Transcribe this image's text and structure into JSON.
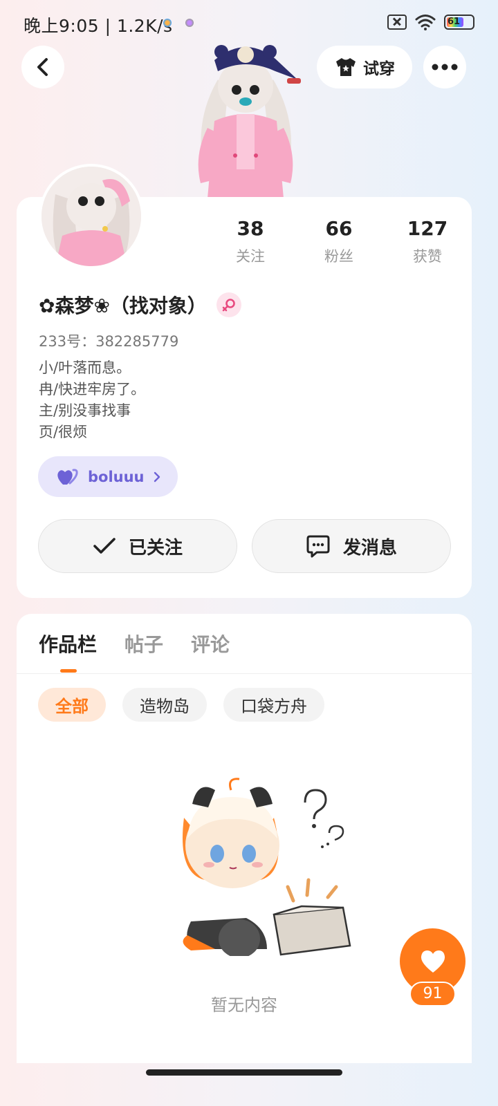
{
  "status_bar": {
    "time": "晚上9:05 | 1.2K/s",
    "battery": "61"
  },
  "header": {
    "tryon_label": "试穿"
  },
  "profile": {
    "stats": [
      {
        "value": "38",
        "label": "关注"
      },
      {
        "value": "66",
        "label": "粉丝"
      },
      {
        "value": "127",
        "label": "获赞"
      }
    ],
    "nickname": "✿森梦❀（找对象）",
    "uid": "233号：382285779",
    "bio": [
      "小/叶落而息。",
      "冉/快进牢房了。",
      "主/别没事找事",
      "页/很烦"
    ],
    "couple_name": "boluuu",
    "follow_label": "已关注",
    "message_label": "发消息"
  },
  "works": {
    "tabs": [
      "作品栏",
      "帖子",
      "评论"
    ],
    "filters": [
      "全部",
      "造物岛",
      "口袋方舟"
    ],
    "empty_text": "暂无内容"
  },
  "like": {
    "count": "91"
  },
  "colors": {
    "accent": "#ff7a1a",
    "couple": "#6d62d6",
    "gender": "#e84a7f"
  }
}
